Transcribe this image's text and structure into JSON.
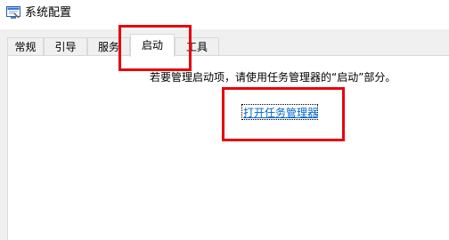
{
  "window": {
    "title": "系统配置",
    "icon": "msconfig-app-icon"
  },
  "tabs": [
    {
      "label": "常规",
      "selected": false
    },
    {
      "label": "引导",
      "selected": false
    },
    {
      "label": "服务",
      "selected": false
    },
    {
      "label": "启动",
      "selected": true
    },
    {
      "label": "工具",
      "selected": false
    }
  ],
  "startup": {
    "message": "若要管理启动项，请使用任务管理器的“启动”部分。",
    "task_manager_link": "打开任务管理器"
  },
  "colors": {
    "highlight": "#e8000b",
    "link": "#0066cc",
    "tab_border": "#d9d9d9",
    "window_bg": "#f0f0f0"
  }
}
